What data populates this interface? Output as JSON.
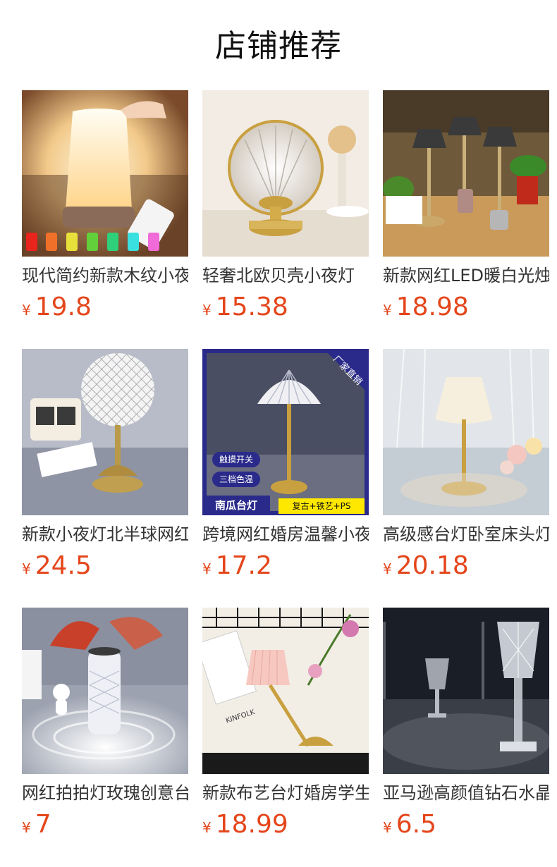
{
  "page": {
    "title": "店铺推荐"
  },
  "currency_symbol": "¥",
  "products": [
    {
      "name": "现代简约新款木纹小夜灯",
      "price": "19.8",
      "image": "wood-grain-night-lamp-photo"
    },
    {
      "name": "轻奢北欧贝壳小夜灯",
      "price": "15.38",
      "image": "shell-crystal-lamp-photo"
    },
    {
      "name": "新款网红LED暖白光烛台",
      "price": "18.98",
      "image": "metal-mushroom-lamps-photo"
    },
    {
      "name": "新款小夜灯北半球网红",
      "price": "24.5",
      "image": "mesh-globe-lamp-photo"
    },
    {
      "name": "跨境网红婚房温馨小夜灯",
      "price": "17.2",
      "image": "pumpkin-crystal-lamp-photo",
      "overlays": {
        "corner": "厂家直销",
        "tag1": "触摸开关",
        "tag2": "三档色温",
        "left_label": "南瓜台灯",
        "right_label": "复古+铁艺+PS"
      }
    },
    {
      "name": "高级感台灯卧室床头灯",
      "price": "20.18",
      "image": "frilled-glass-lamp-photo"
    },
    {
      "name": "网红拍拍灯玫瑰创意台灯",
      "price": "7",
      "image": "rose-crystal-tube-lamp-photo"
    },
    {
      "name": "新款布艺台灯婚房学生",
      "price": "18.99",
      "image": "pleated-fabric-lamp-photo",
      "overlays": {
        "book_text": "KINFOLK"
      }
    },
    {
      "name": "亚马逊高颜值钻石水晶灯",
      "price": "6.5",
      "image": "diamond-crystal-lamp-photo"
    }
  ]
}
